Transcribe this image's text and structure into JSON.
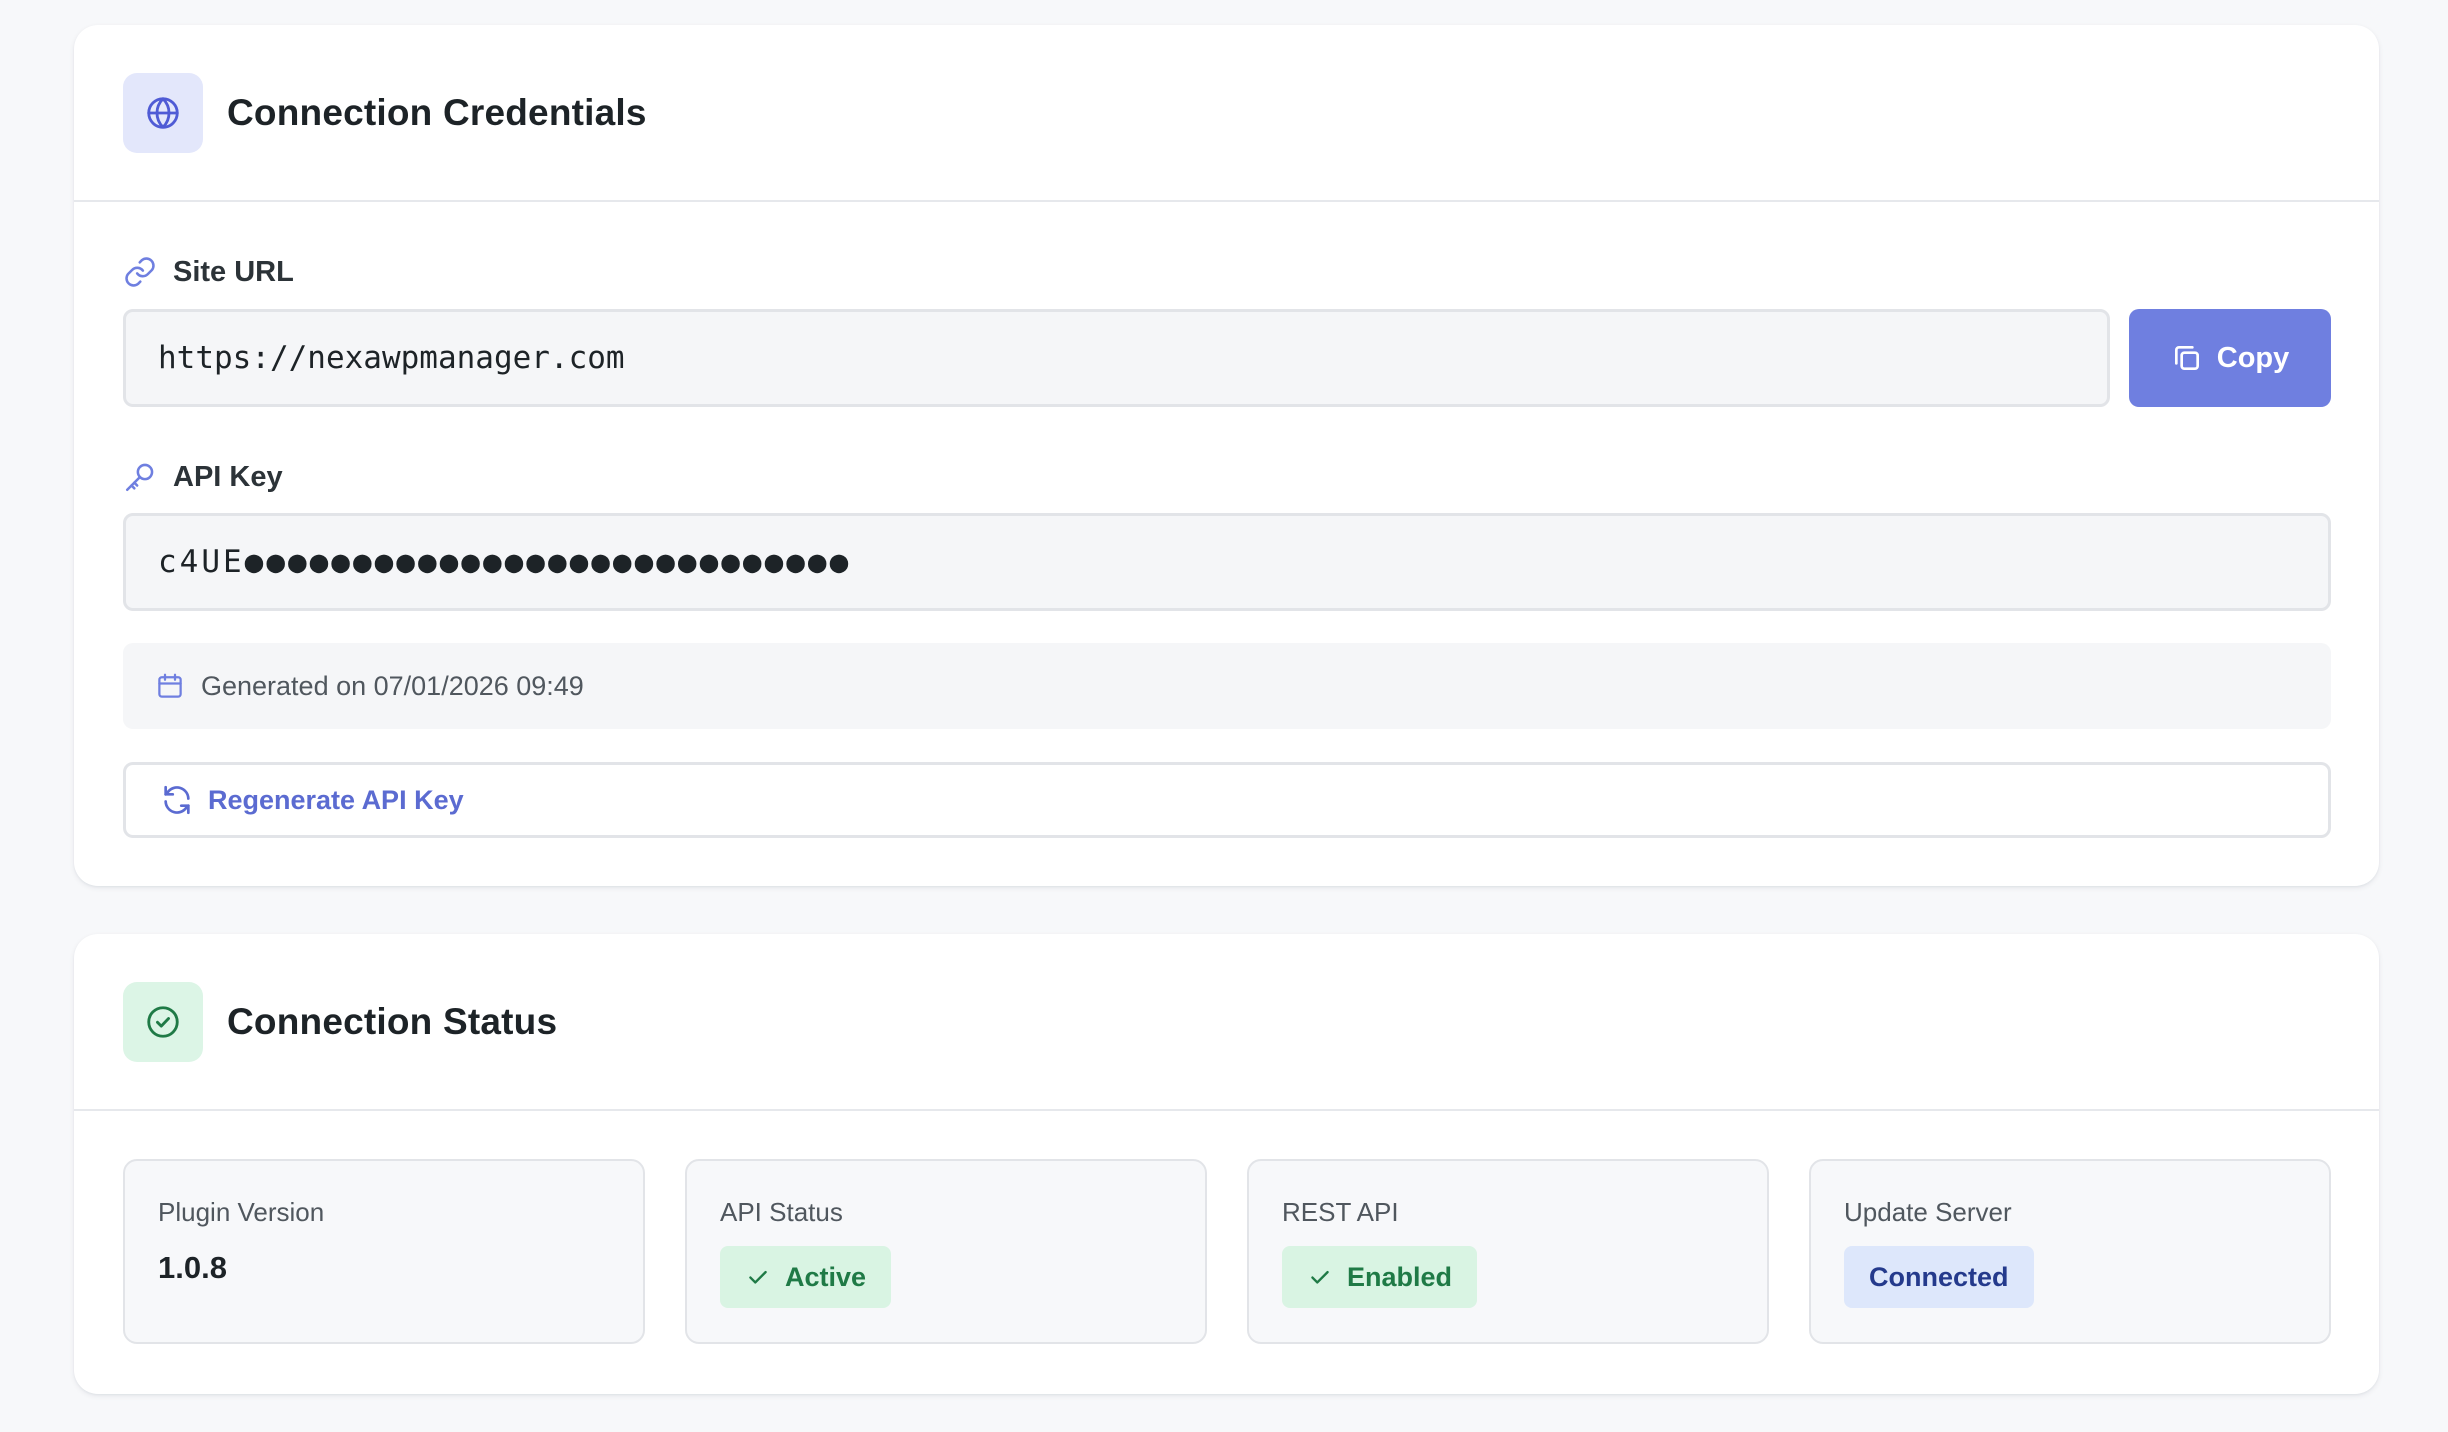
{
  "credentials": {
    "title": "Connection Credentials",
    "site_url_label": "Site URL",
    "site_url_value": "https://nexawpmanager.com",
    "copy_label": "Copy",
    "api_key_label": "API Key",
    "api_key_value": "c4UE●●●●●●●●●●●●●●●●●●●●●●●●●●●●",
    "generated_text": "Generated on 07/01/2026 09:49",
    "regenerate_label": "Regenerate API Key"
  },
  "status": {
    "title": "Connection Status",
    "plugin_version_label": "Plugin Version",
    "plugin_version_value": "1.0.8",
    "api_status_label": "API Status",
    "api_status_value": "Active",
    "rest_api_label": "REST API",
    "rest_api_value": "Enabled",
    "update_server_label": "Update Server",
    "update_server_value": "Connected"
  },
  "icons": {
    "credentials_header": "globe-icon",
    "status_header": "check-circle-icon",
    "site_url": "link-icon",
    "api_key": "key-icon",
    "copy": "copy-icon",
    "generated": "calendar-icon",
    "regenerate": "refresh-icon",
    "badge_check": "check-icon"
  },
  "colors": {
    "accent": "#6f7fe0",
    "accent_text": "#5b6bd1",
    "success_bg": "#d9f4e3",
    "success_text": "#1f7a46",
    "info_bg": "#dde7fb",
    "info_text": "#243a8c"
  }
}
